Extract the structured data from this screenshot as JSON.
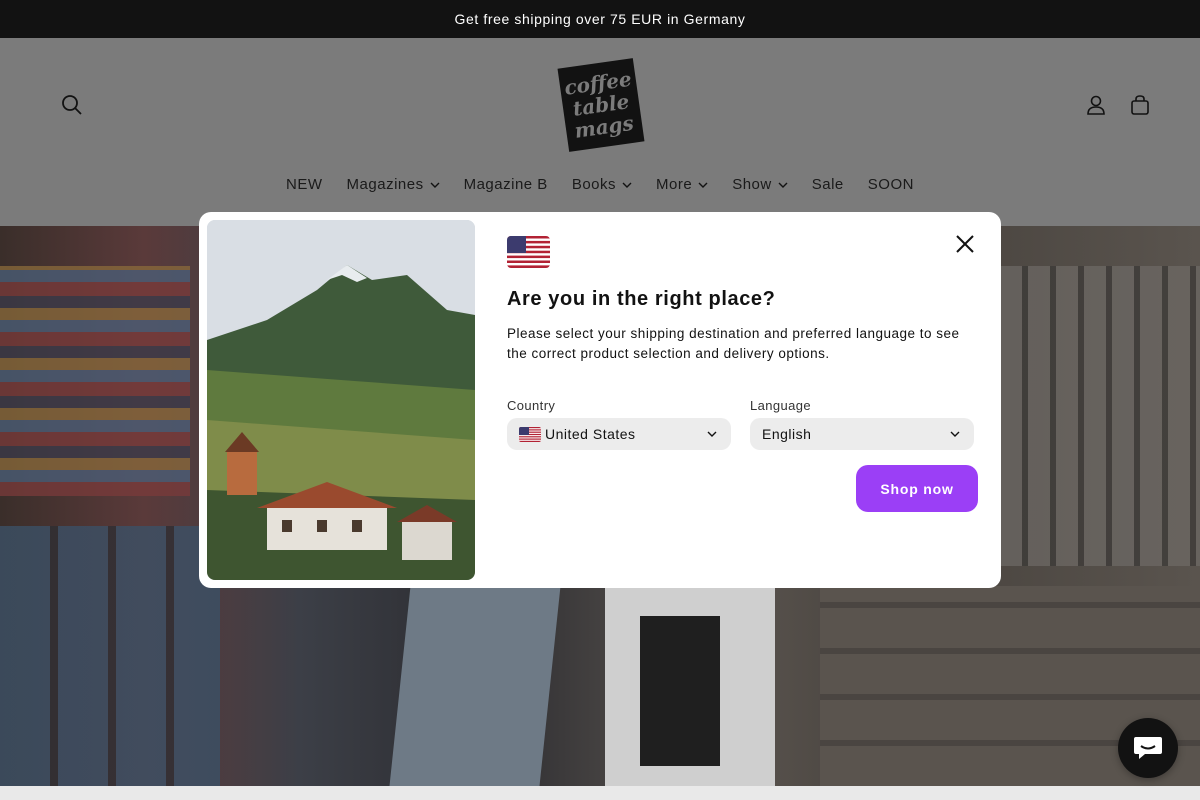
{
  "announcement": "Get free shipping over 75 EUR in Germany",
  "header": {
    "logo_lines": [
      "coffee",
      "table",
      "mags"
    ],
    "nav": [
      {
        "label": "NEW",
        "dropdown": false
      },
      {
        "label": "Magazines",
        "dropdown": true
      },
      {
        "label": "Magazine B",
        "dropdown": false
      },
      {
        "label": "Books",
        "dropdown": true
      },
      {
        "label": "More",
        "dropdown": true
      },
      {
        "label": "Show",
        "dropdown": true
      },
      {
        "label": "Sale",
        "dropdown": false
      },
      {
        "label": "SOON",
        "dropdown": false
      }
    ],
    "icons": {
      "search": "search-icon",
      "account": "user-icon",
      "cart": "bag-icon"
    }
  },
  "modal": {
    "title": "Are you in the right place?",
    "description": "Please select your shipping destination and preferred language to see the correct product selection and delivery options.",
    "country_label": "Country",
    "country_value": "United States",
    "language_label": "Language",
    "language_value": "English",
    "button_label": "Shop now",
    "flag": "us-flag-icon",
    "close_icon": "close-icon"
  },
  "chat_icon": "chat-bubble-icon",
  "colors": {
    "announcement_bg": "#121212",
    "header_bg": "#7b7b7b",
    "accent": "#9b3ff6",
    "chat_bg": "#121212"
  }
}
